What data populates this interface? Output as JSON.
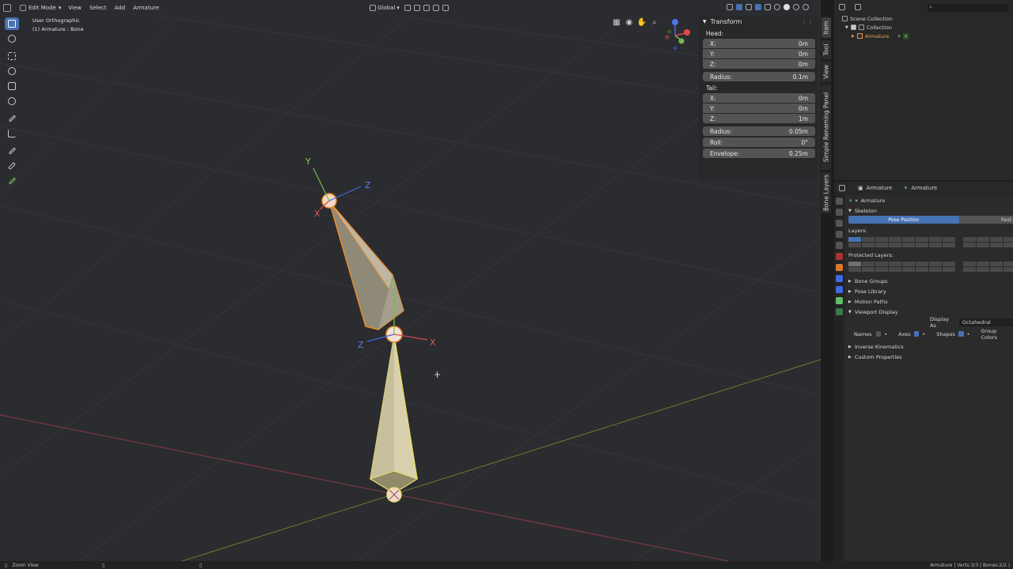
{
  "header": {
    "mode": "Edit Mode",
    "menus": [
      "View",
      "Select",
      "Add",
      "Armature"
    ],
    "transform_orientation": "Global"
  },
  "viewport": {
    "view_name": "User Orthographic",
    "object_info": "(1) Armature : Bone",
    "axis_labels": {
      "x": "X",
      "y": "Y",
      "z": "Z"
    }
  },
  "npanel": {
    "title": "Transform",
    "head_label": "Head:",
    "head": {
      "x_label": "X:",
      "x": "0m",
      "y_label": "Y:",
      "y": "0m",
      "z_label": "Z:",
      "z": "0m"
    },
    "head_radius_label": "Radius:",
    "head_radius": "0.1m",
    "tail_label": "Tail:",
    "tail": {
      "x_label": "X:",
      "x": "0m",
      "y_label": "Y:",
      "y": "0m",
      "z_label": "Z:",
      "z": "1m"
    },
    "tail_radius_label": "Radius:",
    "tail_radius": "0.05m",
    "roll_label": "Roll:",
    "roll": "0°",
    "envelope_label": "Envelope:",
    "envelope": "0.25m"
  },
  "sidebar_tabs": [
    "Item",
    "Tool",
    "View",
    "Simple Renaming Panel",
    "Bone Layers"
  ],
  "outliner": {
    "scene_collection": "Scene Collection",
    "collection": "Collection",
    "armature": "Armature"
  },
  "properties": {
    "breadcrumb_object": "Armature",
    "breadcrumb_data": "Armature",
    "data_name": "Armature",
    "skeleton_label": "Skeleton",
    "pose_position": "Pose Position",
    "rest_position": "Rest",
    "layers_label": "Layers:",
    "protected_layers_label": "Protected Layers:",
    "bone_groups": "Bone Groups",
    "pose_library": "Pose Library",
    "motion_paths": "Motion Paths",
    "viewport_display": "Viewport Display",
    "display_as_label": "Display As",
    "display_as": "Octahedral",
    "names_label": "Names",
    "axes_label": "Axes",
    "shapes_label": "Shapes",
    "group_colors_label": "Group Colors",
    "inverse_kinematics": "Inverse Kinematics",
    "custom_properties": "Custom Properties"
  },
  "status": {
    "left": "Zoom View",
    "right": "Armature | Verts:3/3 | Bones:2/2 |"
  },
  "colors": {
    "accent": "#4772b3",
    "selected_bone": "#e8a25a",
    "active_bone": "#f3e9a0"
  }
}
